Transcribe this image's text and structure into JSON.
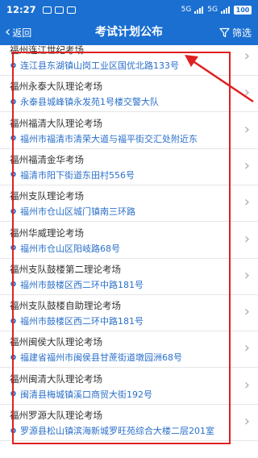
{
  "status_bar": {
    "time": "12:27",
    "network": "5G",
    "signal": "5G",
    "battery": "100"
  },
  "header": {
    "back_label": "返回",
    "title": "考试计划公布",
    "filter_label": "筛选"
  },
  "colors": {
    "header_bg": "#1a6fd1",
    "address_text": "#2a6fc9",
    "highlight": "#e02020"
  },
  "items": [
    {
      "title": "福州连江世纪考场",
      "address": "连江县东湖镇山岗工业区国优北路133号"
    },
    {
      "title": "福州永泰大队理论考场",
      "address": "永泰县城峰镇永发苑1号楼交警大队"
    },
    {
      "title": "福州福清大队理论考场",
      "address": "福州市福清市清荣大道与福平街交汇处附近东"
    },
    {
      "title": "福州福清金华考场",
      "address": "福清市阳下街道东田村556号"
    },
    {
      "title": "福州支队理论考场",
      "address": "福州市仓山区城门镇南三环路"
    },
    {
      "title": "福州华威理论考场",
      "address": "福州市仓山区阳岐路68号"
    },
    {
      "title": "福州支队鼓楼第二理论考场",
      "address": "福州市鼓楼区西二环中路181号"
    },
    {
      "title": "福州支队鼓楼自助理论考场",
      "address": "福州市鼓楼区西二环中路181号"
    },
    {
      "title": "福州闽侯大队理论考场",
      "address": "福建省福州市闽侯县甘蔗街道墩园洲68号"
    },
    {
      "title": "福州闽清大队理论考场",
      "address": "闽清县梅城镇溪口商贸大街192号"
    },
    {
      "title": "福州罗源大队理论考场",
      "address": "罗源县松山镇滨海新城罗旺苑综合大楼二层201室"
    }
  ]
}
